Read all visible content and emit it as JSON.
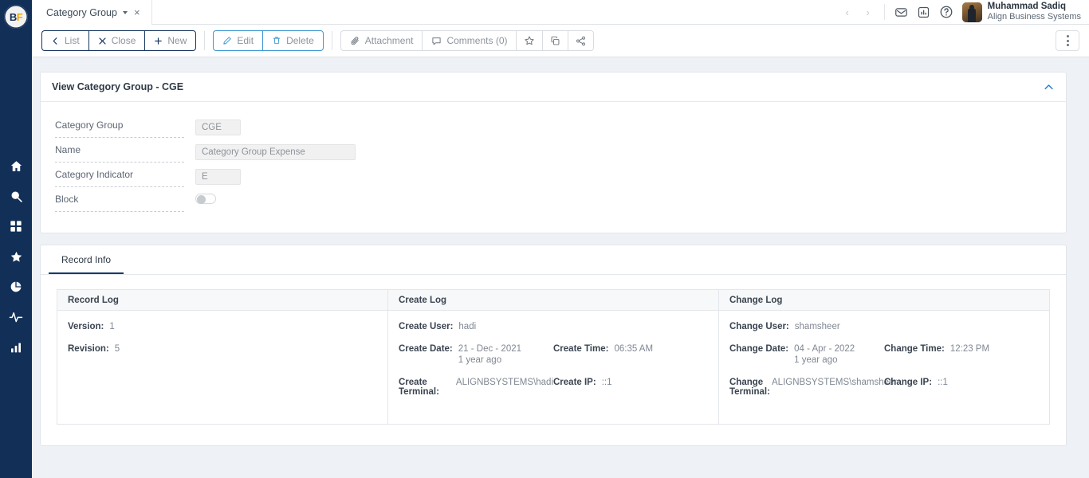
{
  "app": {
    "logo_text_left": "B",
    "logo_text_right": "F"
  },
  "sidebar": {
    "items": [
      {
        "name": "home-icon",
        "label": "Home"
      },
      {
        "name": "search-icon",
        "label": "Search"
      },
      {
        "name": "apps-grid-icon",
        "label": "Apps"
      },
      {
        "name": "star-icon",
        "label": "Favorites"
      },
      {
        "name": "pie-chart-icon",
        "label": "Reports"
      },
      {
        "name": "activity-icon",
        "label": "Activity"
      },
      {
        "name": "bar-chart-icon",
        "label": "Analytics"
      }
    ]
  },
  "topbar": {
    "tab_label": "Category Group",
    "tab_close_label": "×",
    "prev_label": "‹",
    "next_label": "›",
    "icons": [
      "mail-icon",
      "dashboard-icon",
      "help-icon"
    ],
    "user_name": "Muhammad Sadiq",
    "user_org": "Align Business Systems"
  },
  "toolbar": {
    "group_nav": [
      {
        "label": "List",
        "icon": "chevron-left-icon"
      },
      {
        "label": "Close",
        "icon": "close-x-icon"
      },
      {
        "label": "New",
        "icon": "plus-icon"
      }
    ],
    "group_edit": [
      {
        "label": "Edit",
        "icon": "pencil-icon"
      },
      {
        "label": "Delete",
        "icon": "trash-icon"
      }
    ],
    "group_extra": [
      {
        "label": "Attachment",
        "icon": "paperclip-icon"
      },
      {
        "label": "Comments (0)",
        "icon": "comment-icon"
      },
      {
        "label": "",
        "icon": "star-outline-icon"
      },
      {
        "label": "",
        "icon": "copy-icon"
      },
      {
        "label": "",
        "icon": "share-icon"
      }
    ],
    "kebab_label": "More actions"
  },
  "form_card": {
    "title": "View Category Group - CGE",
    "collapse_icon": "chevron-up-icon",
    "fields": [
      {
        "label": "Category Group",
        "value": "CGE",
        "type": "text",
        "size": "sm"
      },
      {
        "label": "Name",
        "value": "Category Group Expense",
        "type": "text",
        "size": "lg"
      },
      {
        "label": "Category Indicator",
        "value": "E",
        "type": "text",
        "size": "sm"
      },
      {
        "label": "Block",
        "value": "",
        "type": "toggle",
        "size": ""
      }
    ]
  },
  "tabs": [
    {
      "label": "Record Info",
      "active": true
    }
  ],
  "logs": {
    "record_log": {
      "title": "Record Log",
      "rows": [
        {
          "k1": "Version:",
          "v1": "1",
          "ago1": "",
          "k2": "",
          "v2": ""
        },
        {
          "k1": "Revision:",
          "v1": "5",
          "ago1": "",
          "k2": "",
          "v2": ""
        }
      ]
    },
    "create_log": {
      "title": "Create Log",
      "rows": [
        {
          "k1": "Create User:",
          "v1": "hadi",
          "ago1": "",
          "k2": "",
          "v2": ""
        },
        {
          "k1": "Create Date:",
          "v1": "21 - Dec - 2021",
          "ago1": "1 year ago",
          "k2": "Create Time:",
          "v2": "06:35 AM"
        },
        {
          "k1": "Create Terminal:",
          "v1": "ALIGNBSYSTEMS\\hadi",
          "ago1": "",
          "k2": "Create IP:",
          "v2": "::1"
        }
      ]
    },
    "change_log": {
      "title": "Change Log",
      "rows": [
        {
          "k1": "Change User:",
          "v1": "shamsheer",
          "ago1": "",
          "k2": "",
          "v2": ""
        },
        {
          "k1": "Change Date:",
          "v1": "04 - Apr - 2022",
          "ago1": "1 year ago",
          "k2": "Change Time:",
          "v2": "12:23 PM"
        },
        {
          "k1": "Change\nTerminal:",
          "v1": "ALIGNBSYSTEMS\\shamsheer",
          "ago1": "",
          "k2": "Change IP:",
          "v2": "::1"
        }
      ]
    }
  },
  "colors": {
    "sidebar_bg": "#123057",
    "page_bg": "#eef2f7",
    "accent_blue": "#3d97d3",
    "navy_border": "#16365e",
    "tab_active": "#163a66",
    "logo_gold": "#f0a500"
  }
}
